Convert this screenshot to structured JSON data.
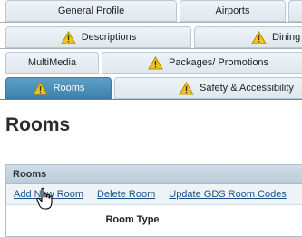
{
  "tabs": {
    "row1": [
      {
        "label": "General Profile"
      },
      {
        "label": "Airports"
      }
    ],
    "row2": [
      {
        "label": "Descriptions",
        "icon": "warning-icon"
      },
      {
        "label": "Dining",
        "icon": "warning-icon"
      }
    ],
    "row3": [
      {
        "label": "MultiMedia"
      },
      {
        "label": "Packages/ Promotions",
        "icon": "warning-icon"
      }
    ],
    "row4": [
      {
        "label": "Rooms",
        "icon": "warning-icon",
        "active": true
      },
      {
        "label": "Safety & Accessibility",
        "icon": "warning-icon"
      }
    ]
  },
  "page": {
    "title": "Rooms"
  },
  "panel": {
    "title": "Rooms",
    "links": [
      "Add New Room",
      "Delete Room",
      "Update GDS Room Codes"
    ],
    "column_header": "Room Type"
  },
  "colors": {
    "active_tab": "#4a8fbb",
    "tab_bg": "#e6edf2",
    "link": "#1a4f8b",
    "warning": "#f2c318"
  }
}
